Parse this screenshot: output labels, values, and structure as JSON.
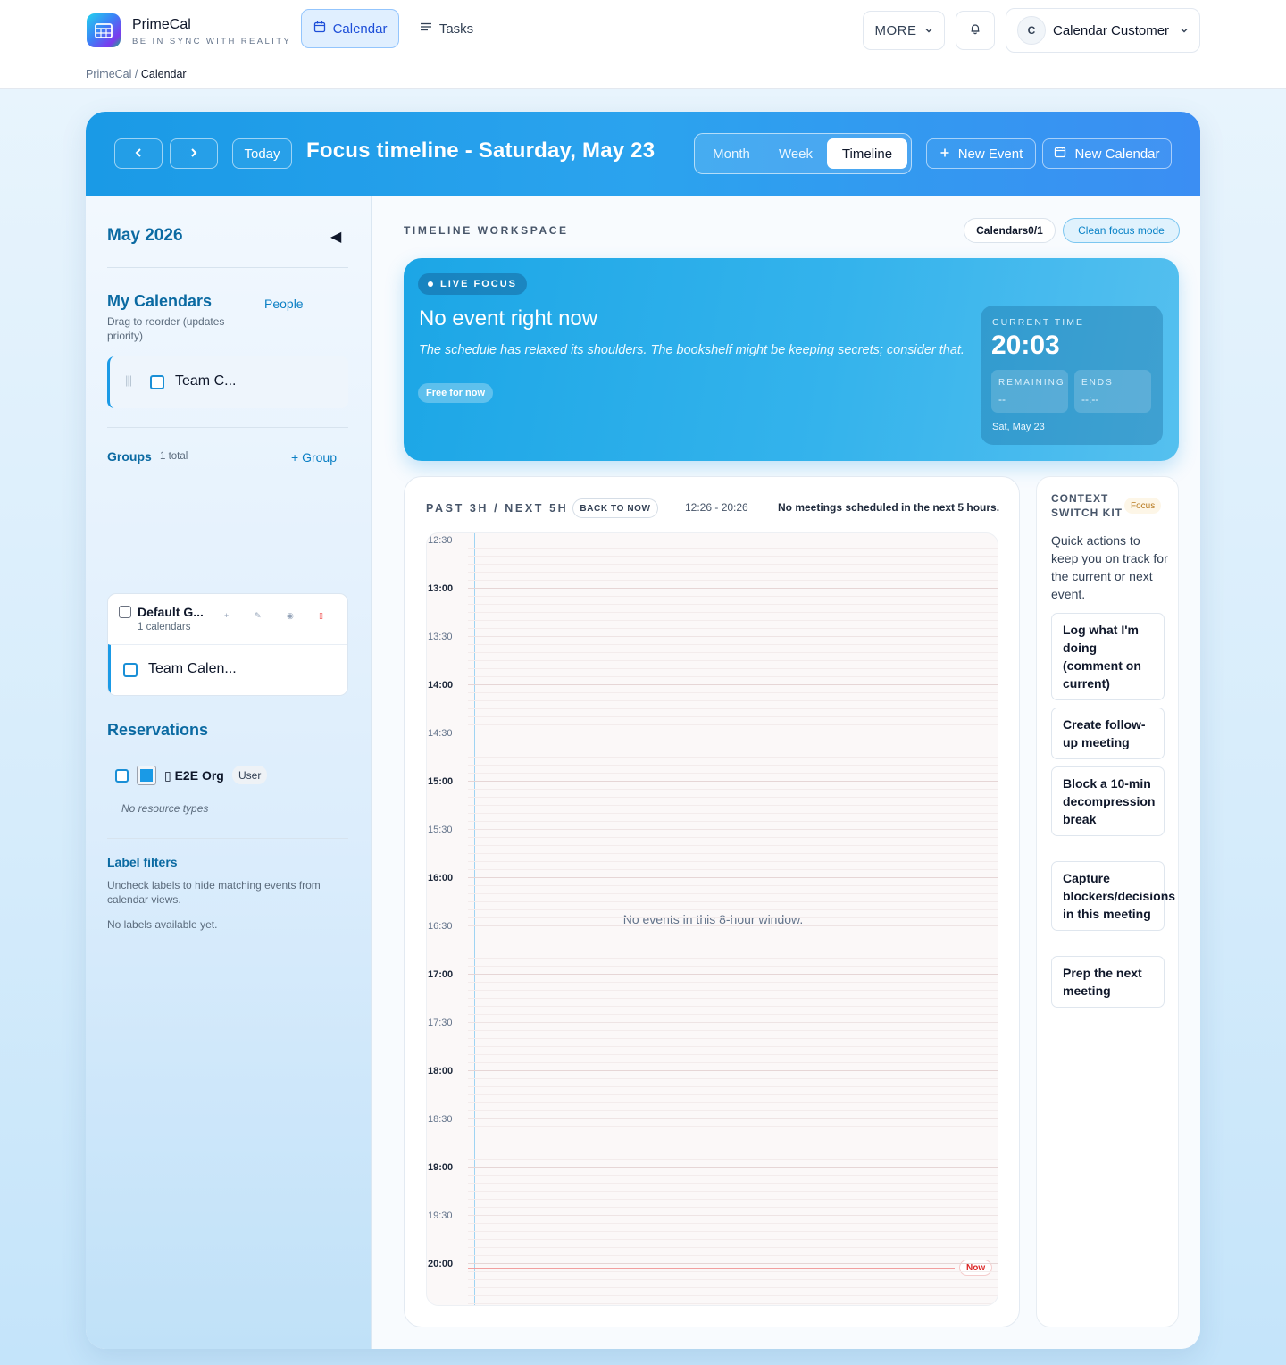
{
  "app": {
    "name": "PrimeCal",
    "tagline": "BE IN SYNC WITH REALITY"
  },
  "nav": {
    "calendar": "Calendar",
    "tasks": "Tasks",
    "more": "MORE",
    "user_initial": "C",
    "user_name": "Calendar Customer"
  },
  "breadcrumb": {
    "root": "PrimeCal",
    "separator": "/",
    "current": "Calendar"
  },
  "header": {
    "today": "Today",
    "title": "Focus timeline - Saturday, May 23",
    "views": [
      "Month",
      "Week",
      "Timeline"
    ],
    "active_view": "Timeline",
    "new_event": "New Event",
    "new_calendar": "New Calendar"
  },
  "sidebar": {
    "month": "May 2026",
    "my_calendars": "My Calendars",
    "people": "People",
    "drag_note": "Drag to reorder (updates priority)",
    "calendar_item": "Team C...",
    "groups_title": "Groups",
    "groups_count": "1 total",
    "add_group": "+ Group",
    "group_name": "Default G...",
    "group_sub": "1 calendars",
    "group_calendar": "Team Calen...",
    "reservations_title": "Reservations",
    "org_name": "▯ E2E Org",
    "org_role": "User",
    "no_resources": "No resource types",
    "label_filters_title": "Label filters",
    "label_filters_note": "Uncheck labels to hide matching events from calendar views.",
    "no_labels": "No labels available yet."
  },
  "workspace": {
    "label": "TIMELINE WORKSPACE",
    "calendars_pill": "Calendars0/1",
    "clean_focus": "Clean focus mode"
  },
  "focus": {
    "live": "LIVE FOCUS",
    "title": "No event right now",
    "message": "The schedule has relaxed its shoulders. The bookshelf might be keeping secrets; consider that.",
    "free": "Free for now",
    "current_time_label": "CURRENT TIME",
    "current_time": "20:03",
    "remaining_label": "REMAINING",
    "remaining_value": "--",
    "ends_label": "ENDS",
    "ends_value": "--:--",
    "date": "Sat, May 23"
  },
  "timeline": {
    "range_label": "PAST 3H / NEXT 5H",
    "back_to_now": "BACK TO NOW",
    "span": "12:26 - 20:26",
    "status": "No meetings scheduled in the next 5 hours.",
    "times": [
      "12:30",
      "13:00",
      "13:30",
      "14:00",
      "14:30",
      "15:00",
      "15:30",
      "16:00",
      "16:30",
      "17:00",
      "17:30",
      "18:00",
      "18:30",
      "19:00",
      "19:30",
      "20:00"
    ],
    "empty": "No events in this 8-hour window.",
    "now": "Now"
  },
  "context": {
    "title": "CONTEXT SWITCH KIT",
    "tag": "Focus",
    "description": "Quick actions to keep you on track for the current or next event.",
    "actions": [
      "Log what I'm doing (comment on current)",
      "Create follow-up meeting",
      "Block a 10-min decompression break",
      "Capture blockers/decisions in this meeting",
      "Prep the next meeting"
    ]
  },
  "colors": {
    "accent": "#1a9ae6",
    "brand_link": "#0b6aa2",
    "now_line": "#f2a0a0",
    "now_text": "#dc2626"
  },
  "icons": [
    "app-logo",
    "calendar-icon",
    "list-icon",
    "chevron-down-icon",
    "bell-icon",
    "chevron-left-icon",
    "chevron-right-icon",
    "plus-icon",
    "calendar-plus-icon",
    "triangle-left-icon",
    "drag-handle-icon",
    "plus-small-icon",
    "pencil-icon",
    "eye-icon",
    "trash-icon"
  ]
}
